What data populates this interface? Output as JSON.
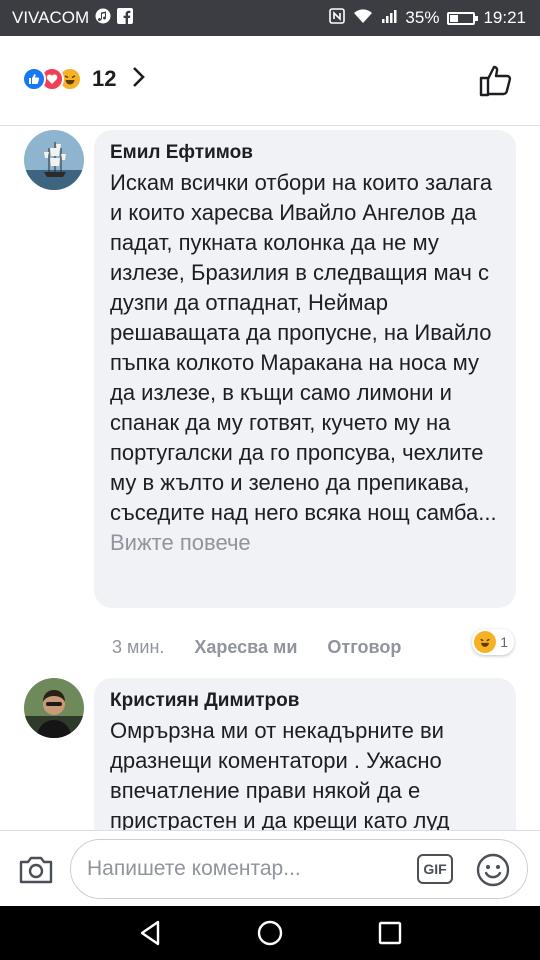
{
  "status_bar": {
    "carrier": "VIVACOM",
    "battery_percent": "35%",
    "battery_level": 0.35,
    "time": "19:21",
    "icons": [
      "music-note-icon",
      "facebook-icon",
      "nfc-icon",
      "wifi-icon",
      "signal-icon",
      "battery-icon"
    ]
  },
  "header": {
    "reaction_types": [
      "like",
      "love",
      "haha"
    ],
    "reaction_count": "12",
    "icons": [
      "chevron-right-icon",
      "thumbs-up-icon"
    ]
  },
  "comments": [
    {
      "author": "Емил Ефтимов",
      "text": "Искам всички отбори на които залага и които харесва Ивайло Ангелов да падат, пукната колонка да не му излезе, Бразилия в следващия мач с дузпи да отпаднат, Неймар решаващата да пропусне, на Ивайло пъпка колкото Маракана на носа му да излезе, в къщи само лимони и спанак да му готвят, кучето му на португалски да го пропсува, чехлите му в жълто и зелено да препикава, съседите над него всяка нощ самба...",
      "see_more": " Вижте повече",
      "time": "3 мин.",
      "like_label": "Харесва ми",
      "reply_label": "Отговор",
      "reaction_count": "1",
      "avatar": "ship-avatar"
    },
    {
      "author": "Кристиян Димитров",
      "text": "Омрързна ми от некадърните ви дразнещи коментатори . Ужасно впечатление прави някой да е пристрастен и да крещи като луд",
      "avatar": "man-avatar"
    }
  ],
  "composer": {
    "placeholder": "Напишете коментар...",
    "gif_label": "GIF",
    "icons": [
      "camera-icon",
      "gif-icon",
      "emoji-icon"
    ]
  },
  "nav_bar": {
    "icons": [
      "back-icon",
      "home-icon",
      "recents-icon"
    ]
  },
  "colors": {
    "status_bar_bg": "#3b3d42",
    "bubble_bg": "#f1f2f6",
    "like_blue": "#1877f2",
    "love_red": "#f33e58",
    "haha_yellow": "#f7b125",
    "meta_gray": "#90949c"
  }
}
